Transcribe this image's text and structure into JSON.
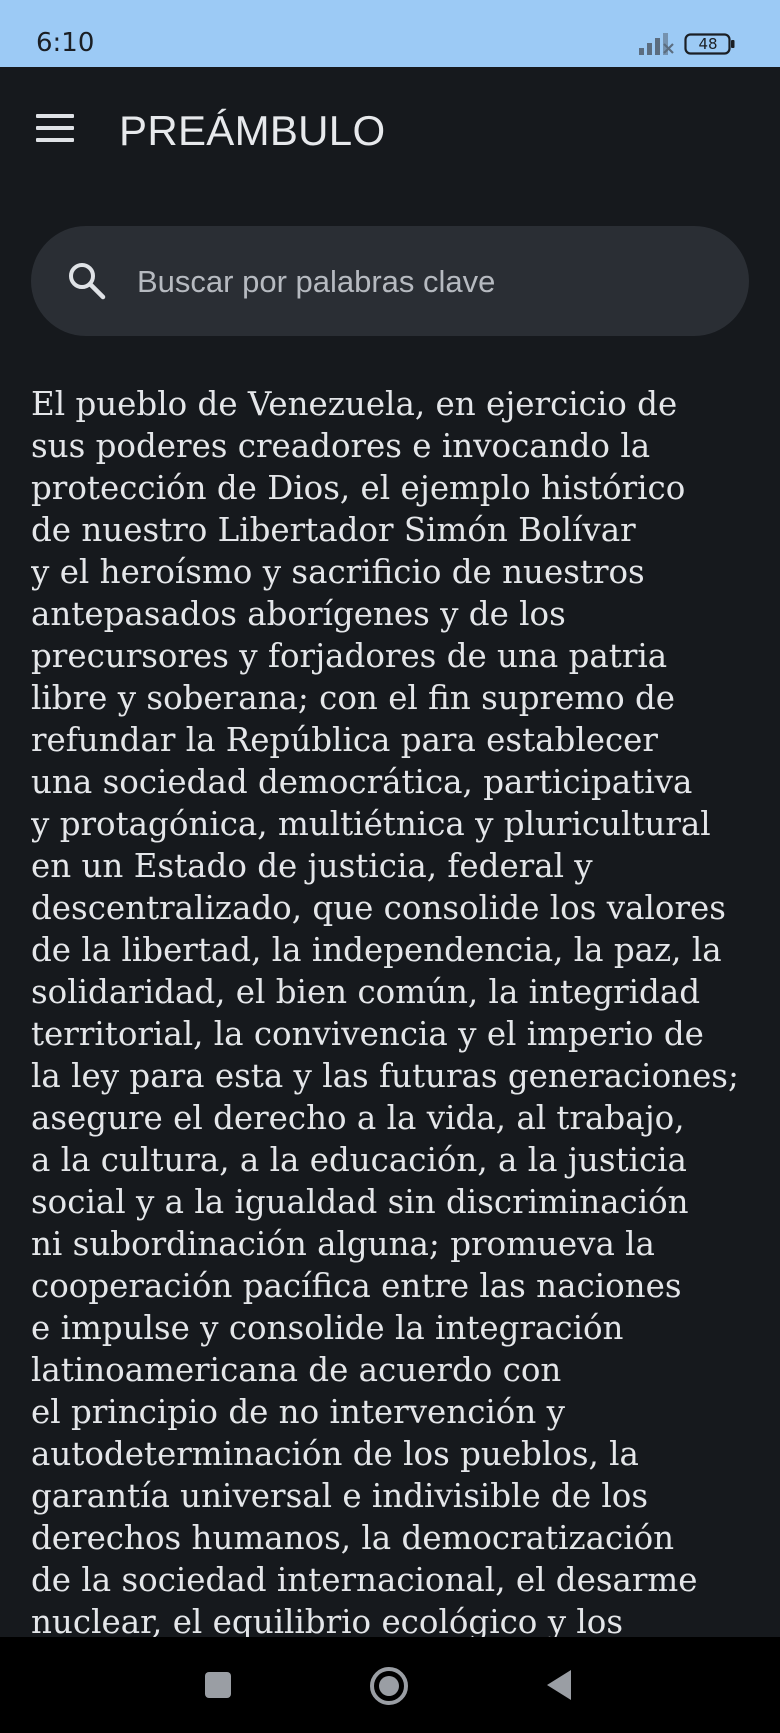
{
  "status_bar": {
    "time": "6:10",
    "battery": "48",
    "icons": [
      "signal-icon",
      "battery-icon"
    ]
  },
  "app_bar": {
    "title": "PREÁMBULO",
    "menu_icon": "hamburger-menu-icon"
  },
  "search": {
    "placeholder": "Buscar por palabras clave",
    "value": "",
    "icon": "search-icon"
  },
  "preamble": {
    "lines": [
      "El pueblo de Venezuela, en ejercicio de",
      "sus poderes creadores e invocando la",
      "protección de Dios, el ejemplo histórico",
      "de nuestro Libertador Simón Bolívar",
      "y el heroísmo y sacrificio de nuestros",
      "antepasados aborígenes y de los",
      "precursores y forjadores de una patria",
      "libre y soberana; con el fin supremo de",
      "refundar la República para establecer",
      "una sociedad democrática, participativa",
      "y protagónica, multiétnica y pluricultural",
      "en un Estado de justicia, federal y",
      "descentralizado, que consolide los valores",
      "de la libertad, la independencia, la paz, la",
      "solidaridad, el bien común, la integridad",
      "territorial, la convivencia y el imperio de",
      "la ley para esta y las futuras generaciones;",
      "asegure el derecho a la vida, al trabajo,",
      "a la cultura, a la educación, a la justicia",
      "social y a la igualdad sin discriminación",
      "ni subordinación alguna; promueva la",
      "cooperación pacífica entre las naciones",
      "e impulse y consolide la integración",
      "latinoamericana de acuerdo con",
      "el principio de no intervención y",
      "autodeterminación de los pueblos, la",
      "garantía universal e indivisible de los",
      "derechos humanos, la democratización",
      "de la sociedad internacional, el desarme",
      "nuclear, el equilibrio ecológico y los"
    ]
  },
  "nav_bar": {
    "buttons": [
      "recents-square-icon",
      "home-circle-icon",
      "back-triangle-icon"
    ]
  },
  "colors": {
    "status_bar_bg": "#9ccaf5",
    "background": "#16191d",
    "search_bg": "#2a2e34",
    "text": "#e4e6e9"
  }
}
